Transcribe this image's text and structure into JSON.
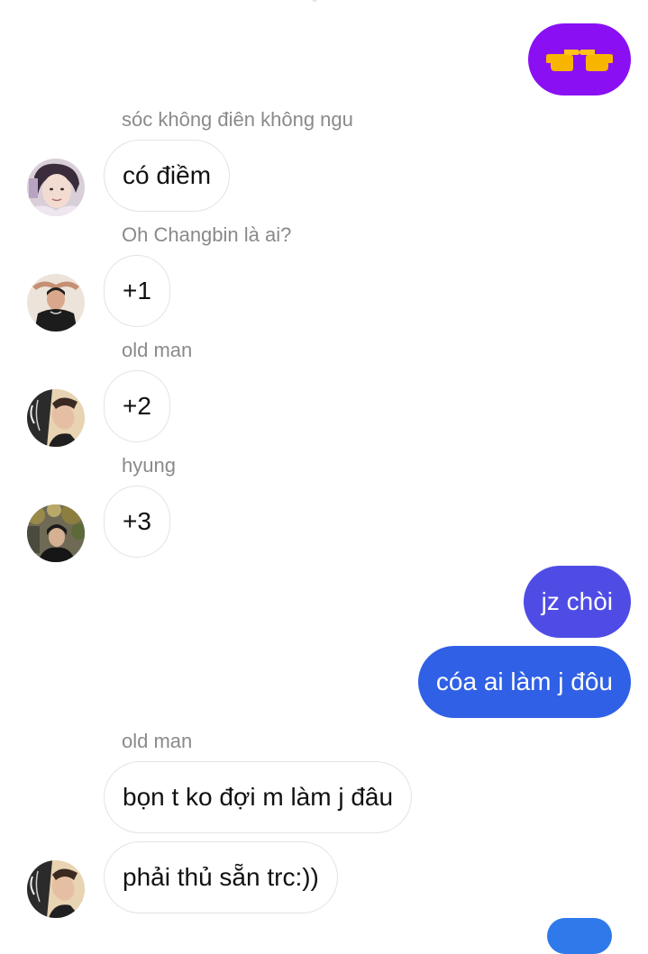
{
  "colors": {
    "outgoing_purple": "#8a10f3",
    "outgoing_indigo": "#4f4ce6",
    "outgoing_blue": "#3060e5",
    "incoming_border": "#e3e3e3",
    "sender_name": "#8a8a8a"
  },
  "outgoing": [
    {
      "icon": "pointing-hands-emoji"
    },
    {
      "text": "jz chòi"
    },
    {
      "text": "cóa ai làm j đôu"
    }
  ],
  "incoming": [
    {
      "sender": "sóc không điên không ngu",
      "text": "có điềm",
      "avatar": "avatar-soc"
    },
    {
      "sender": "Oh Changbin là ai?",
      "text": "+1",
      "avatar": "avatar-changbin"
    },
    {
      "sender": "old man",
      "text": "+2",
      "avatar": "avatar-old-man"
    },
    {
      "sender": "hyung",
      "text": "+3",
      "avatar": "avatar-hyung"
    },
    {
      "sender": "old man",
      "text": "bọn t ko đợi m làm j đâu",
      "avatar": ""
    },
    {
      "sender": "",
      "text": "phải thủ sẵn trc:))",
      "avatar": "avatar-old-man"
    }
  ]
}
